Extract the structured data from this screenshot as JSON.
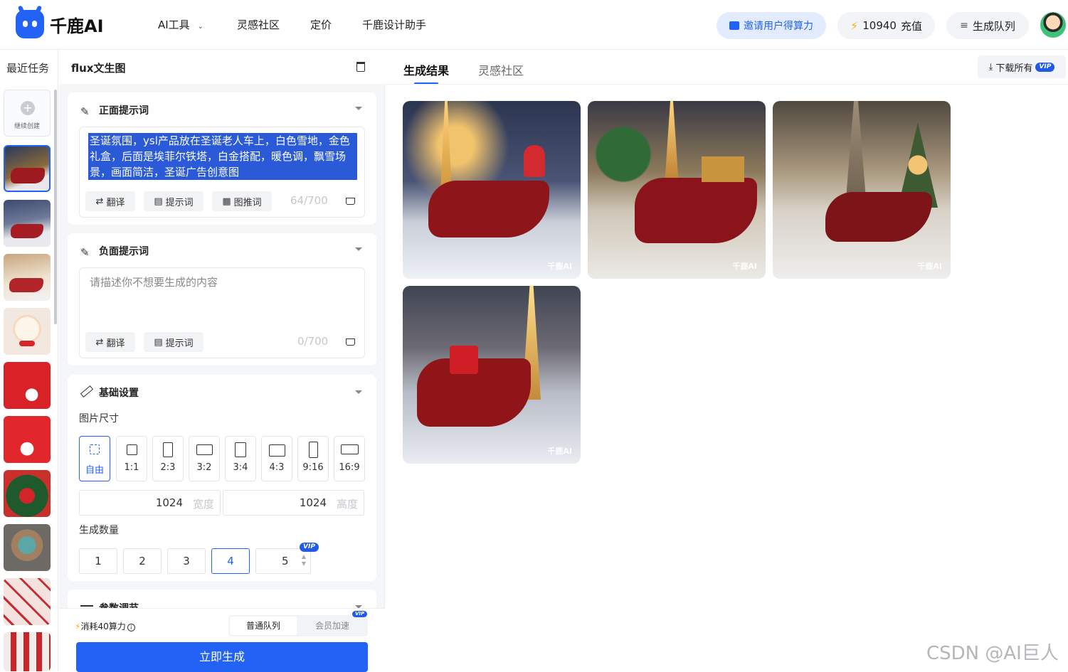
{
  "header": {
    "brand": "千鹿AI",
    "nav": [
      "AI工具",
      "灵感社区",
      "定价",
      "千鹿设计助手"
    ],
    "invite": "邀请用户得算力",
    "credits": "10940",
    "recharge": "充值",
    "queue": "生成队列",
    "accent": "#2263f5"
  },
  "sidebar": {
    "title": "最近任务",
    "continue": "继续创建",
    "thumbs": [
      "ysl-sleigh",
      "santa-sleigh",
      "santa-sleigh-eiffel",
      "reindeer-toy",
      "santa-red-1",
      "santa-red-2",
      "santa-gifts",
      "snake-toy",
      "santa-pattern",
      "santa-crowd"
    ]
  },
  "panel": {
    "title": "flux文生图",
    "positive": {
      "title": "正面提示词",
      "text": "圣诞氛围，ysl产品放在圣诞老人车上，白色雪地，金色礼盒，后面是埃菲尔铁塔，白金搭配，暖色调，飘雪场景，画面简洁，圣诞广告创意图",
      "translate": "翻译",
      "prompt": "提示词",
      "img2prompt": "图推词",
      "count": "64/700"
    },
    "negative": {
      "title": "负面提示词",
      "placeholder": "请描述你不想要生成的内容",
      "translate": "翻译",
      "prompt": "提示词",
      "count": "0/700"
    },
    "basic": {
      "title": "基础设置",
      "size_label": "图片尺寸",
      "ratios": [
        "自由",
        "1:1",
        "2:3",
        "3:2",
        "3:4",
        "4:3",
        "9:16",
        "16:9"
      ],
      "selected_ratio": "自由",
      "width": "1024",
      "width_label": "宽度",
      "height": "1024",
      "height_label": "高度",
      "quantity_label": "生成数量",
      "quantities": [
        "1",
        "2",
        "3",
        "4",
        "5"
      ],
      "selected_quantity": "4",
      "vip": "VIP"
    },
    "params_title": "参数调节",
    "footer": {
      "cost": "消耗40算力",
      "normal_queue": "普通队列",
      "vip_queue": "会员加速",
      "generate": "立即生成"
    }
  },
  "main": {
    "tabs": [
      "生成结果",
      "灵感社区"
    ],
    "active_tab": "生成结果",
    "download_all": "下载所有",
    "watermark": "千鹿AI",
    "results": [
      "result-1",
      "result-2",
      "result-3",
      "result-4"
    ]
  },
  "page_watermark": "CSDN @AI巨人"
}
